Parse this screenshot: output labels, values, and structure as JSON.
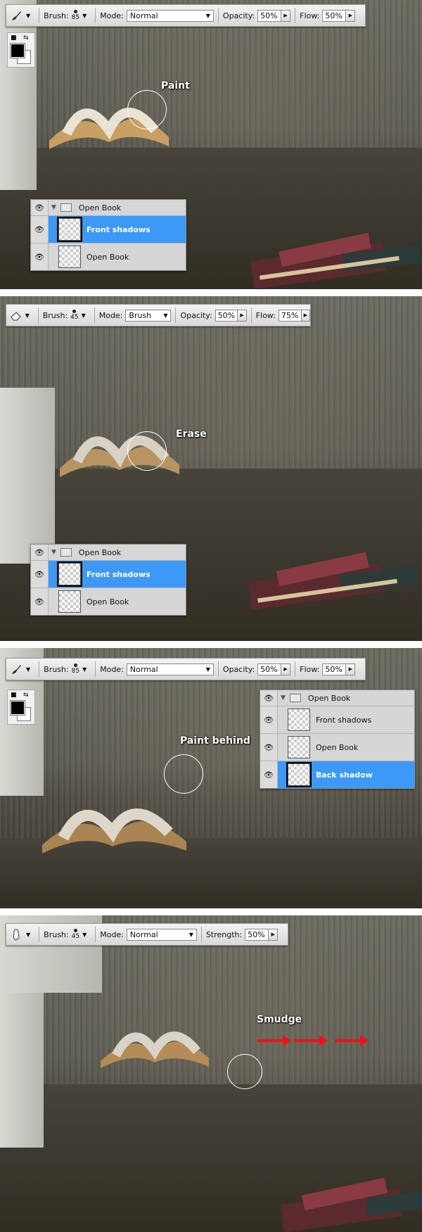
{
  "panels": [
    {
      "toolbar": {
        "tool_icon": "brush-icon",
        "brush_label": "Brush:",
        "brush_size": "85",
        "mode_label": "Mode:",
        "mode_value": "Normal",
        "opacity_label": "Opacity:",
        "opacity_value": "50%",
        "flow_label": "Flow:",
        "flow_value": "50%"
      },
      "caption": "Paint",
      "layers": [
        {
          "name": "Open Book",
          "type": "group"
        },
        {
          "name": "Front shadows",
          "selected": true
        },
        {
          "name": "Open Book",
          "selected": false
        }
      ]
    },
    {
      "toolbar": {
        "tool_icon": "eraser-icon",
        "brush_label": "Brush:",
        "brush_size": "45",
        "mode_label": "Mode:",
        "mode_value": "Brush",
        "opacity_label": "Opacity:",
        "opacity_value": "50%",
        "flow_label": "Flow:",
        "flow_value": "75%"
      },
      "caption": "Erase",
      "layers": [
        {
          "name": "Open Book",
          "type": "group"
        },
        {
          "name": "Front shadows",
          "selected": true
        },
        {
          "name": "Open Book",
          "selected": false
        }
      ]
    },
    {
      "toolbar": {
        "tool_icon": "brush-icon",
        "brush_label": "Brush:",
        "brush_size": "85",
        "mode_label": "Mode:",
        "mode_value": "Normal",
        "opacity_label": "Opacity:",
        "opacity_value": "50%",
        "flow_label": "Flow:",
        "flow_value": "50%"
      },
      "caption": "Paint behind",
      "layers": [
        {
          "name": "Open Book",
          "type": "group"
        },
        {
          "name": "Front shadows",
          "selected": false
        },
        {
          "name": "Open Book",
          "selected": false
        },
        {
          "name": "Back shadow",
          "selected": true
        }
      ]
    },
    {
      "toolbar": {
        "tool_icon": "smudge-icon",
        "brush_label": "Brush:",
        "brush_size": "45",
        "mode_label": "Mode:",
        "mode_value": "Normal",
        "strength_label": "Strength:",
        "strength_value": "50%"
      },
      "caption": "Smudge"
    }
  ],
  "colors": {
    "selected_layer": "#3d99f6",
    "arrow": "#e8141a",
    "foreground": "#000000",
    "background": "#ffffff"
  }
}
